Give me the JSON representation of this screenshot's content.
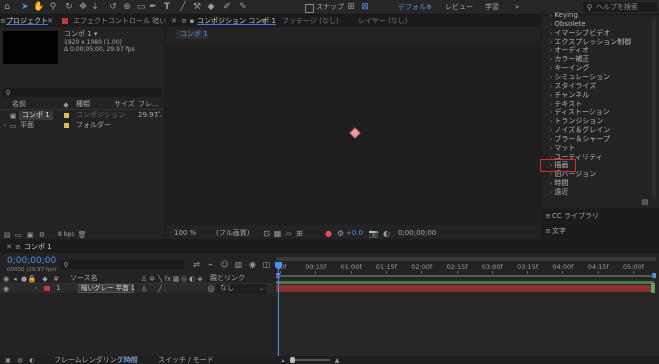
{
  "colors": {
    "accent": "#3d7ee0",
    "blue_text": "#4f8fe8",
    "highlight_red": "#e0282b",
    "label_red": "#c0393b",
    "label_yellow": "#d8c14a",
    "track_green": "#4a7a49",
    "track_red": "#8a3030"
  },
  "toolbar": {
    "snap_label": "スナップ",
    "workspaces": [
      "デフォルト",
      "レビュー",
      "学習"
    ],
    "more_label": "»",
    "search_placeholder": "ヘルプを検索"
  },
  "project_panel": {
    "tab_label": "プロジェクト",
    "effect_controls_tab": "エフェクトコントロール 暗いグレ",
    "comp_name": "コンポ 1 ▾",
    "comp_info_line1": "1920 x 1080 (1.00)",
    "comp_info_line2": "Δ 0;00;05;00, 29.97 fps",
    "search_placeholder": "",
    "columns": {
      "name": "名前",
      "type": "種類",
      "size": "サイズ",
      "frame": "フレ..."
    },
    "rows": [
      {
        "name": "コンポ 1",
        "type": "コンポジション",
        "frame": "29.97"
      },
      {
        "name": "平面",
        "type": "フォルダー",
        "frame": ""
      }
    ],
    "bpc": "8 bpc"
  },
  "comp_panel": {
    "tab_label": "コンポジション コンポ 1",
    "footage_tab": "フッテージ (なし)",
    "layer_tab": "レイヤー (なし)",
    "breadcrumb": "コンポ 1",
    "zoom": "100 %",
    "resolution": "(フル画質)",
    "exposure": "+0.0",
    "timecode": "0;00;00;00"
  },
  "effects_panel": {
    "items": [
      "Keying",
      "Obsolete",
      "イマーシブビデオ",
      "エクスプレッション制御",
      "オーディオ",
      "カラー補正",
      "キーイング",
      "シミュレーション",
      "スタイライズ",
      "チャンネル",
      "テキスト",
      "ディストーション",
      "トランジション",
      "ノイズ＆グレイン",
      "ブラー＆シャープ",
      "マット",
      "ユーティリティ",
      "描画",
      "旧バージョン",
      "時間",
      "遠近"
    ],
    "highlighted": "描画",
    "cc_library": "CC ライブラリ",
    "text_panel": "文字"
  },
  "timeline": {
    "tab_label": "コンポ 1",
    "timecode": "0;00;00;00",
    "fps_info": "00000 (29.97 fps)",
    "columns": {
      "source": "ソース名",
      "parent": "親とリンク"
    },
    "layer": {
      "index": "1",
      "name": "暗いグレー 平面 1",
      "parent": "なし"
    },
    "ticks": [
      "0f",
      "00:15f",
      "01:00f",
      "01:15f",
      "02:00f",
      "02:15f",
      "03:00f",
      "03:15f",
      "04:00f",
      "04:15f",
      "05:00f"
    ],
    "status_render": "フレームレンダリング時間",
    "status_ms": "13ms",
    "status_switch": "スイッチ / モード"
  }
}
